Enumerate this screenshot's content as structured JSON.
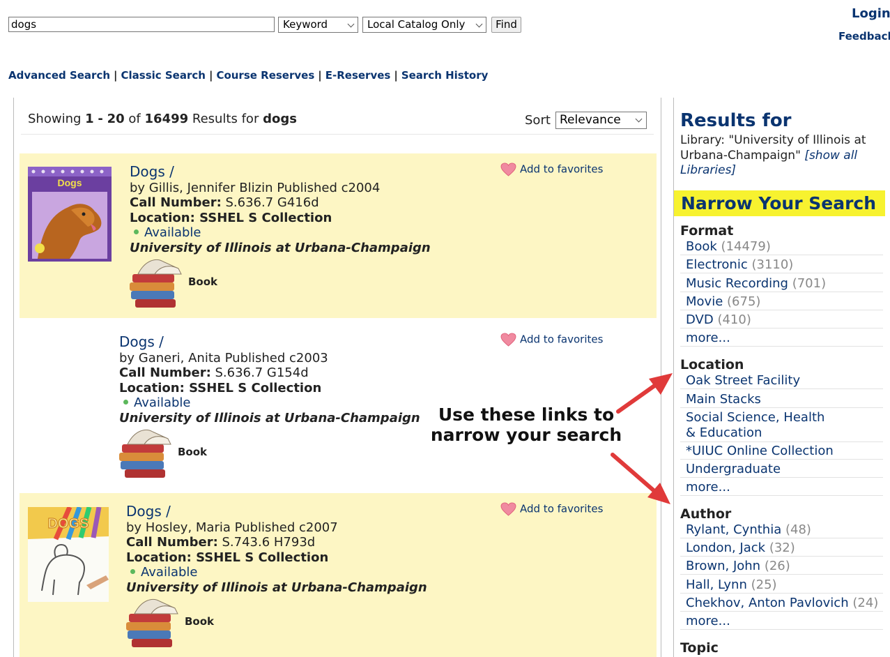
{
  "search": {
    "query": "dogs",
    "type_selected": "Keyword",
    "scope_selected": "Local Catalog Only",
    "find_label": "Find"
  },
  "header": {
    "login": "Login",
    "feedback": "Feedback"
  },
  "nav": {
    "advanced": "Advanced Search",
    "classic": "Classic Search",
    "course_reserves": "Course Reserves",
    "e_reserves": "E-Reserves",
    "history": "Search History",
    "separator": "|"
  },
  "results": {
    "showing_prefix": "Showing",
    "range_start": "1",
    "dash": "-",
    "range_end": "20",
    "of": "of",
    "total": "16499",
    "results_for": "Results for",
    "term": "dogs",
    "sort_label": "Sort",
    "sort_selected": "Relevance",
    "items": [
      {
        "title": "Dogs /",
        "byline": "by Gillis, Jennifer Blizin Published c2004",
        "call_label": "Call Number:",
        "call_number": "S.636.7 G416d",
        "location_label": "Location: SSHEL S Collection",
        "status": "Available",
        "library": "University of Illinois at Urbana-Champaign",
        "format": "Book",
        "favorite": "Add to favorites",
        "cover_text": "Dogs"
      },
      {
        "title": "Dogs /",
        "byline": "by Ganeri, Anita Published c2003",
        "call_label": "Call Number:",
        "call_number": "S.636.7 G154d",
        "location_label": "Location: SSHEL S Collection",
        "status": "Available",
        "library": "University of Illinois at Urbana-Champaign",
        "format": "Book",
        "favorite": "Add to favorites"
      },
      {
        "title": "Dogs /",
        "byline": "by Hosley, Maria Published c2007",
        "call_label": "Call Number:",
        "call_number": "S.743.6 H793d",
        "location_label": "Location: SSHEL S Collection",
        "status": "Available",
        "library": "University of Illinois at Urbana-Champaign",
        "format": "Book",
        "favorite": "Add to favorites",
        "cover_text": "DOGS"
      }
    ]
  },
  "sidebar": {
    "results_for_title": "Results for",
    "library_text": "Library: \"University of Illinois at Urbana-Champaign\"",
    "show_all": "[show all Libraries]",
    "narrow_heading": "Narrow Your Search",
    "more": "more...",
    "format_title": "Format",
    "format_items": [
      {
        "label": "Book",
        "count": "(14479)"
      },
      {
        "label": "Electronic",
        "count": "(3110)"
      },
      {
        "label": "Music Recording",
        "count": "(701)"
      },
      {
        "label": "Movie",
        "count": "(675)"
      },
      {
        "label": "DVD",
        "count": "(410)"
      }
    ],
    "location_title": "Location",
    "location_items": [
      {
        "label": "Oak Street Facility"
      },
      {
        "label": "Main Stacks"
      },
      {
        "label": "Social Science, Health & Education"
      },
      {
        "label": "*UIUC Online Collection"
      },
      {
        "label": "Undergraduate"
      }
    ],
    "author_title": "Author",
    "author_items": [
      {
        "label": "Rylant, Cynthia",
        "count": "(48)"
      },
      {
        "label": "London, Jack",
        "count": "(32)"
      },
      {
        "label": "Brown, John",
        "count": "(26)"
      },
      {
        "label": "Hall, Lynn",
        "count": "(25)"
      },
      {
        "label": "Chekhov, Anton Pavlovich",
        "count": "(24)"
      }
    ],
    "topic_title": "Topic"
  },
  "annotation": {
    "line1": "Use these links to",
    "line2": "narrow your search"
  },
  "colors": {
    "link": "#0a3470",
    "highlight_row": "#fdf6c4",
    "narrow_bg": "#f7f22f",
    "arrow": "#e03a3a"
  }
}
